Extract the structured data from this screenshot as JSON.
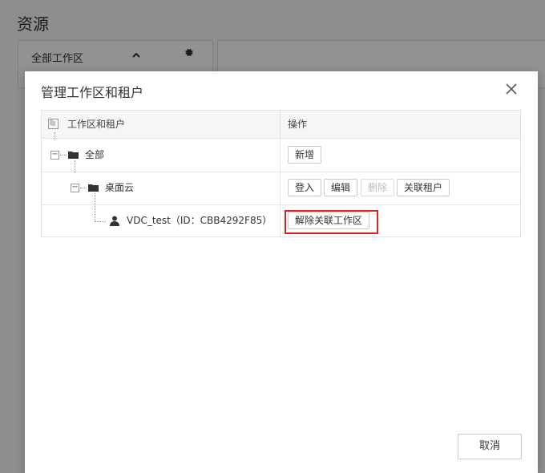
{
  "page": {
    "title": "资源",
    "workspace_panel": {
      "label": "全部工作区"
    }
  },
  "modal": {
    "title": "管理工作区和租户",
    "close_symbol": "✕",
    "columns": {
      "name": "工作区和租户",
      "actions": "操作"
    },
    "rows": [
      {
        "label": "全部",
        "type": "folder",
        "actions": [
          "新增"
        ]
      },
      {
        "label": "桌面云",
        "type": "folder",
        "actions": [
          "登入",
          "编辑",
          "删除",
          "关联租户"
        ],
        "disabled_actions": [
          "删除"
        ]
      },
      {
        "label": "VDC_test（ID：CBB4292F85）",
        "type": "user",
        "actions": [
          "解除关联工作区"
        ],
        "highlighted_action": "解除关联工作区"
      }
    ],
    "footer": {
      "cancel_label": "取消"
    }
  },
  "colors": {
    "highlight": "#e02020",
    "overlay": "#8e8e8e"
  },
  "icons": [
    "gear-icon",
    "chevron-up-icon",
    "close-icon",
    "folder-icon",
    "user-icon",
    "tree-toggle-icon"
  ]
}
